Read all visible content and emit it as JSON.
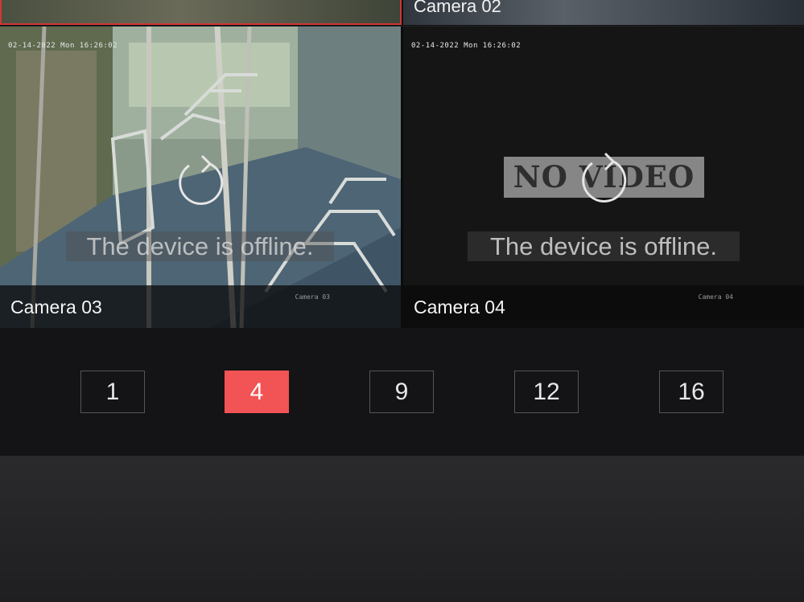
{
  "tiles": {
    "top_left": {
      "name": ""
    },
    "top_right": {
      "name": "Camera 02"
    },
    "camera03": {
      "name": "Camera 03",
      "timestamp": "02-14-2022 Mon 16:26:02",
      "status": "The device is offline.",
      "osd": "Camera 03"
    },
    "camera04": {
      "name": "Camera 04",
      "timestamp": "02-14-2022 Mon 16:26:02",
      "no_video": "NO VIDEO",
      "status": "The device is offline.",
      "osd": "Camera 04"
    }
  },
  "layout_options": [
    "1",
    "4",
    "9",
    "12",
    "16"
  ],
  "selected_layout": "4",
  "colors": {
    "accent": "#f25354",
    "selected_border": "#d33535"
  }
}
